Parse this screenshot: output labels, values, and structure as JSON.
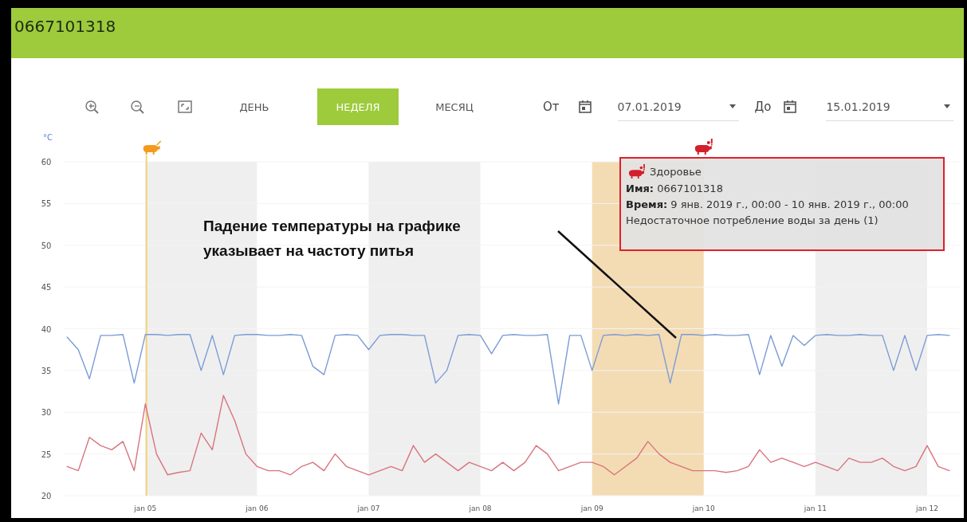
{
  "header": {
    "title": "0667101318"
  },
  "toolbar": {
    "tools": [
      {
        "kind": "zoom_in"
      },
      {
        "kind": "zoom_out"
      },
      {
        "kind": "fit"
      }
    ],
    "periods": [
      {
        "label": "ДЕНЬ",
        "selected": false
      },
      {
        "label": "НЕДЕЛЯ",
        "selected": true
      },
      {
        "label": "МЕСЯЦ",
        "selected": false
      }
    ],
    "range": {
      "from_label": "От",
      "from_value": "07.01.2019",
      "to_label": "До",
      "to_value": "15.01.2019"
    }
  },
  "chart": {
    "chart_data": {
      "type": "line",
      "ylabel": "°C",
      "categories": [
        null,
        null,
        null,
        null,
        null,
        null,
        null,
        "jan 05",
        null,
        null,
        null,
        null,
        null,
        null,
        null,
        null,
        null,
        "jan 06",
        null,
        null,
        null,
        null,
        null,
        null,
        null,
        null,
        null,
        "jan 07",
        null,
        null,
        null,
        null,
        null,
        null,
        null,
        null,
        null,
        "jan 08",
        null,
        null,
        null,
        null,
        null,
        null,
        null,
        null,
        null,
        "jan 09",
        null,
        null,
        null,
        null,
        null,
        null,
        null,
        null,
        null,
        "jan 10",
        null,
        null,
        null,
        null,
        null,
        null,
        null,
        null,
        null,
        "jan 11",
        null,
        null,
        null,
        null,
        null,
        null,
        null,
        null,
        null,
        "jan 12",
        null,
        null
      ],
      "series": [
        {
          "color": "#7b9bd6",
          "values": [
            39.0,
            37.5,
            34,
            39.2,
            39.2,
            39.3,
            33.5,
            39.3,
            39.3,
            39.2,
            39.3,
            39.3,
            35,
            39.2,
            34.5,
            39.2,
            39.3,
            39.3,
            39.2,
            39.2,
            39.3,
            39.2,
            35.5,
            34.5,
            39.2,
            39.3,
            39.2,
            37.5,
            39.2,
            39.3,
            39.3,
            39.2,
            39.2,
            33.5,
            35,
            39.2,
            39.3,
            39.2,
            37,
            39.2,
            39.3,
            39.2,
            39.2,
            39.3,
            31,
            39.2,
            39.2,
            35,
            39.2,
            39.3,
            39.2,
            39.3,
            39.2,
            39.3,
            33.5,
            39.3,
            39.3,
            39.2,
            39.3,
            39.2,
            39.2,
            39.3,
            34.5,
            39.2,
            35.5,
            39.2,
            38,
            39.2,
            39.3,
            39.2,
            39.2,
            39.3,
            39.2,
            39.2,
            35,
            39.2,
            35,
            39.2,
            39.3,
            39.2
          ]
        },
        {
          "color": "#d9737d",
          "values": [
            23.5,
            23,
            27,
            26,
            25.5,
            26.5,
            23,
            31,
            25,
            22.5,
            22.8,
            23,
            27.5,
            25.5,
            32,
            29,
            25,
            23.5,
            23,
            23,
            22.5,
            23.5,
            24,
            23,
            25,
            23.5,
            23,
            22.5,
            23,
            23.5,
            23,
            26,
            24,
            25,
            24,
            23,
            24,
            23.5,
            23,
            24,
            23,
            24,
            26,
            25,
            23,
            23.5,
            24,
            24,
            23.5,
            22.5,
            23.5,
            24.5,
            26.5,
            25,
            24,
            23.5,
            23,
            23,
            23,
            22.8,
            23,
            23.5,
            25.5,
            24,
            24.5,
            24,
            23.5,
            24,
            23.5,
            23,
            24.5,
            24,
            24,
            24.5,
            23.5,
            23,
            23.5,
            26,
            23.5,
            23
          ]
        }
      ],
      "ylim": [
        20,
        60
      ],
      "grid": true,
      "yticks": [
        20,
        25,
        30,
        35,
        40,
        45,
        50,
        55,
        60
      ]
    },
    "day_bands": [
      {
        "selected": false
      },
      {
        "selected": false
      },
      {
        "selected": true
      },
      {
        "selected": false
      }
    ],
    "events": [
      {
        "kind": "heat"
      },
      {
        "kind": "health"
      }
    ],
    "tooltip": {
      "kind": "health",
      "title": "Здоровье",
      "lines": [
        "**Имя:** 0667101318",
        "**Время:** 9 янв. 2019 г., 00:00 - 10 янв. 2019 г., 00:00",
        "Недостаточное потребление воды за день (1)"
      ]
    },
    "callout": {
      "text": "Падение температуры на графике указывает на частоту питья"
    }
  }
}
